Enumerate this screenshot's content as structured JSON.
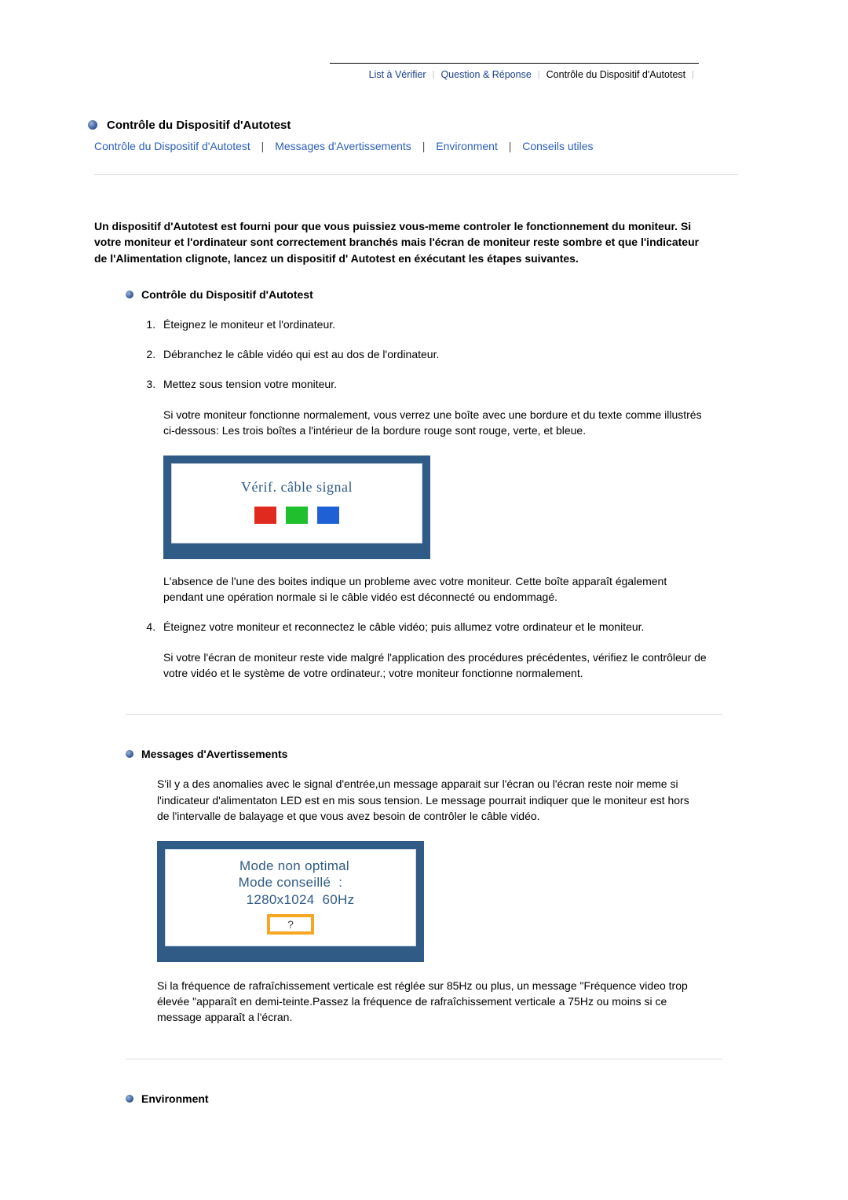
{
  "topnav": {
    "items": [
      {
        "label": "List à Vérifier",
        "current": false
      },
      {
        "label": "Question & Réponse",
        "current": false
      },
      {
        "label": "Contrôle du Dispositif d'Autotest",
        "current": true
      }
    ]
  },
  "title": "Contrôle du Dispositif d'Autotest",
  "anchors": [
    "Contrôle du Dispositif d'Autotest",
    "Messages d'Avertissements",
    "Environment",
    "Conseils utiles"
  ],
  "intro": "Un dispositif d'Autotest est fourni pour que vous puissiez vous-meme controler le fonctionnement du moniteur. Si votre moniteur et l'ordinateur sont correctement branchés mais l'écran de moniteur reste sombre et que l'indicateur de l'Alimentation clignote, lancez un dispositif d' Autotest en éxécutant les étapes suivantes.",
  "sections": {
    "autotest": {
      "title": "Contrôle du Dispositif d'Autotest",
      "steps": [
        {
          "text": "Éteignez le moniteur et l'ordinateur."
        },
        {
          "text": "Débranchez le câble vidéo qui est au dos de l'ordinateur."
        },
        {
          "text": "Mettez sous tension votre moniteur.",
          "after": "Si votre moniteur fonctionne normalement, vous verrez une boîte avec une bordure et du texte comme illustrés ci-dessous: Les trois boîtes a l'intérieur de la bordure rouge sont rouge, verte, et bleue.",
          "monitor_text": "Vérif. câble signal",
          "after2": "L'absence de l'une des boites indique un probleme avec votre moniteur. Cette boîte apparaît également pendant une opération normale si le câble vidéo est déconnecté ou endommagé."
        },
        {
          "text": "Éteignez votre moniteur et reconnectez le câble vidéo; puis allumez votre ordinateur et le moniteur.",
          "after": "Si votre l'écran de moniteur reste vide malgré l'application des procédures précédentes, vérifiez le contrôleur de votre vidéo et le système de votre ordinateur.; votre moniteur fonctionne normalement."
        }
      ]
    },
    "warnings": {
      "title": "Messages d'Avertissements",
      "para1": "S'il y a des anomalies avec le signal d'entrée,un message apparait sur l'écran ou l'écran reste noir meme si l'indicateur d'alimentaton LED est en mis sous tension. Le message pourrait indiquer que le moniteur est hors de l'intervalle de balayage et que vous avez besoin de contrôler le câble vidéo.",
      "monitor_lines": "  Mode non optimal\nMode conseillé  :\n     1280x1024  60Hz",
      "qmark": "?",
      "para2": "Si la fréquence de rafraîchissement verticale est réglée sur 85Hz ou plus, un message \"Fréquence video trop élevée \"apparaît en demi-teinte.Passez la fréquence de rafraîchissement verticale a 75Hz ou moins si ce message apparaît a l'écran."
    },
    "environment": {
      "title": "Environment"
    }
  }
}
